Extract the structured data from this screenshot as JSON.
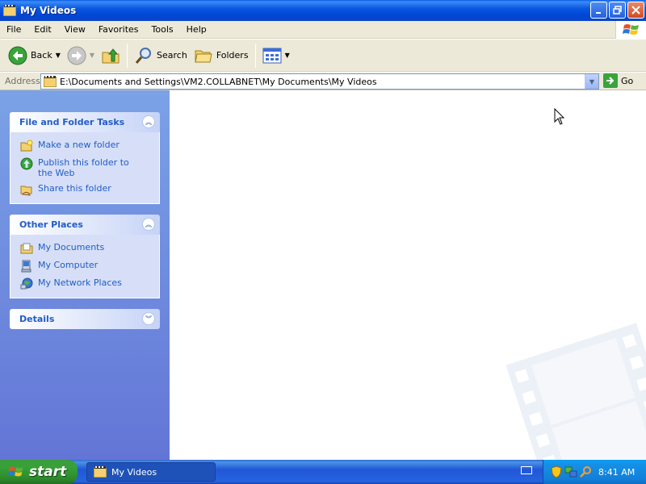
{
  "window": {
    "title": "My Videos"
  },
  "menubar": {
    "items": [
      "File",
      "Edit",
      "View",
      "Favorites",
      "Tools",
      "Help"
    ]
  },
  "toolbar": {
    "back_label": "Back",
    "search_label": "Search",
    "folders_label": "Folders"
  },
  "addressbar": {
    "label": "Address",
    "value": "E:\\Documents and Settings\\VM2.COLLABNET\\My Documents\\My Videos",
    "go_label": "Go"
  },
  "leftpane": {
    "file_tasks": {
      "title": "File and Folder Tasks",
      "items": [
        "Make a new folder",
        "Publish this folder to the Web",
        "Share this folder"
      ]
    },
    "other_places": {
      "title": "Other Places",
      "items": [
        "My Documents",
        "My Computer",
        "My Network Places"
      ]
    },
    "details": {
      "title": "Details"
    }
  },
  "taskbar": {
    "start_label": "start",
    "window_label": "My Videos",
    "clock": "8:41 AM"
  },
  "colors": {
    "title_blue": "#0054e3",
    "task_link": "#215dc6",
    "start_green": "#38a138"
  }
}
